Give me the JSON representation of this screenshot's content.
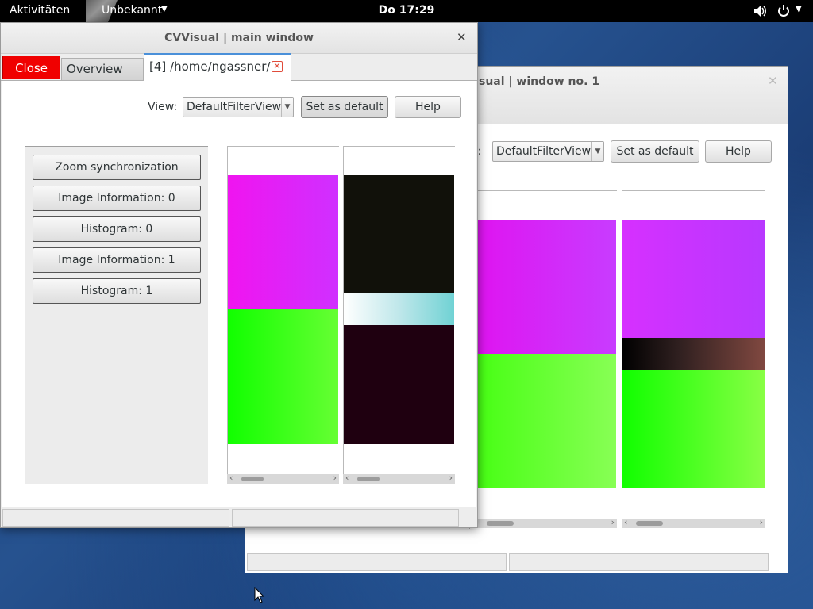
{
  "topbar": {
    "activities": "Aktivitäten",
    "app_menu": "Unbekannt",
    "clock": "Do 17:29"
  },
  "back_window": {
    "title": "sual | window no. 1",
    "view_label": "w:",
    "view_value": "DefaultFilterView",
    "set_default": "Set as default",
    "help": "Help"
  },
  "main_window": {
    "title": "CVVisual | main window",
    "tabs": {
      "close": "Close",
      "overview": "Overview",
      "file": "[4] /home/ngassner/..."
    },
    "view_label": "View:",
    "view_value": "DefaultFilterView",
    "set_default": "Set as default",
    "help": "Help",
    "sidebar_buttons": [
      "Zoom synchronization",
      "Image Information: 0",
      "Histogram: 0",
      "Image Information: 1",
      "Histogram: 1"
    ]
  },
  "colors": {
    "close_tab": "#f00000",
    "magenta": "#d630ff",
    "green": "#33ff22",
    "tab_accent": "#4a90d9"
  }
}
